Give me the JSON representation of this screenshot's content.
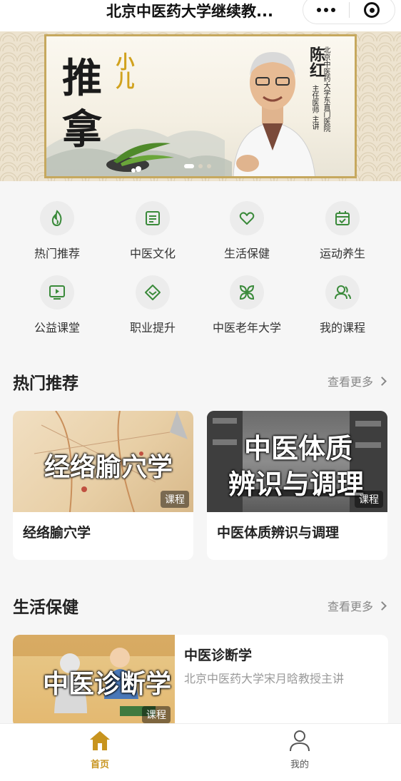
{
  "nav": {
    "title": "北京中医药大学继续教..."
  },
  "banner": {
    "big_char_1": "推",
    "big_char_2": "拿",
    "small_text": "小儿",
    "doctor_name": "陈红",
    "doctor_role": "主任医师 主讲",
    "hospital": "北京中医药大学东直门医院"
  },
  "categories": [
    {
      "label": "热门推荐",
      "icon": "flame-icon"
    },
    {
      "label": "中医文化",
      "icon": "document-icon"
    },
    {
      "label": "生活保健",
      "icon": "heart-icon"
    },
    {
      "label": "运动养生",
      "icon": "calendar-check-icon"
    },
    {
      "label": "公益课堂",
      "icon": "video-icon"
    },
    {
      "label": "职业提升",
      "icon": "chevron-badge-icon"
    },
    {
      "label": "中医老年大学",
      "icon": "leaves-icon"
    },
    {
      "label": "我的课程",
      "icon": "user-icon"
    }
  ],
  "hot": {
    "title": "热门推荐",
    "more": "查看更多",
    "cards": [
      {
        "thumb_text": "经络腧穴学",
        "tag": "课程",
        "name": "经络腧穴学"
      },
      {
        "thumb_text_1": "中医体质",
        "thumb_text_2": "辨识与调理",
        "tag": "课程",
        "name": "中医体质辨识与调理"
      }
    ]
  },
  "life": {
    "title": "生活保健",
    "more": "查看更多",
    "item": {
      "thumb_text": "中医诊断学",
      "tag": "课程",
      "title": "中医诊断学",
      "subtitle": "北京中医药大学宋月晗教授主讲"
    }
  },
  "tabbar": {
    "home": "首页",
    "mine": "我的",
    "active_color": "#c8941e",
    "inactive_color": "#555555"
  },
  "colors": {
    "accent_green": "#3a8a3a",
    "gold": "#c6a85e"
  }
}
